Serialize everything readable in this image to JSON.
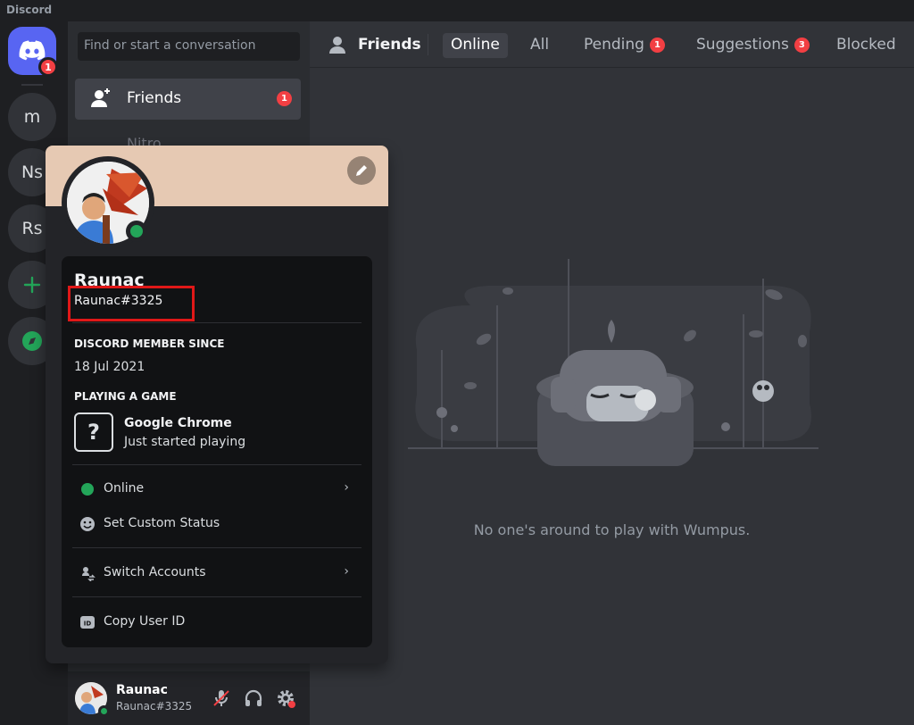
{
  "app": {
    "title": "Discord"
  },
  "servers": {
    "home_badge": "1",
    "items": [
      {
        "label": "m"
      },
      {
        "label": "Ns"
      },
      {
        "label": "Rs"
      }
    ]
  },
  "dm": {
    "search_placeholder": "Find or start a conversation",
    "friends_label": "Friends",
    "friends_badge": "1",
    "nitro_label": "Nitro"
  },
  "user_bar": {
    "name": "Raunac",
    "tag": "Raunac#3325"
  },
  "topbar": {
    "title": "Friends",
    "tabs": [
      {
        "label": "Online",
        "active": true
      },
      {
        "label": "All"
      },
      {
        "label": "Pending",
        "badge": "1"
      },
      {
        "label": "Suggestions",
        "badge": "3"
      },
      {
        "label": "Blocked"
      }
    ]
  },
  "main": {
    "empty_text": "No one's around to play with Wumpus."
  },
  "profile": {
    "name": "Raunac",
    "tag": "Raunac#3325",
    "member_since_heading": "DISCORD MEMBER SINCE",
    "member_since": "18 Jul 2021",
    "activity_heading": "PLAYING A GAME",
    "game_title": "Google Chrome",
    "game_sub": "Just started playing",
    "game_icon_glyph": "?",
    "menu": {
      "online": "Online",
      "custom_status": "Set Custom Status",
      "switch_accounts": "Switch Accounts",
      "copy_id": "Copy User ID"
    }
  },
  "colors": {
    "accent": "#5865f2",
    "online": "#23a559",
    "danger": "#f23f43",
    "highlight": "#e01818"
  }
}
